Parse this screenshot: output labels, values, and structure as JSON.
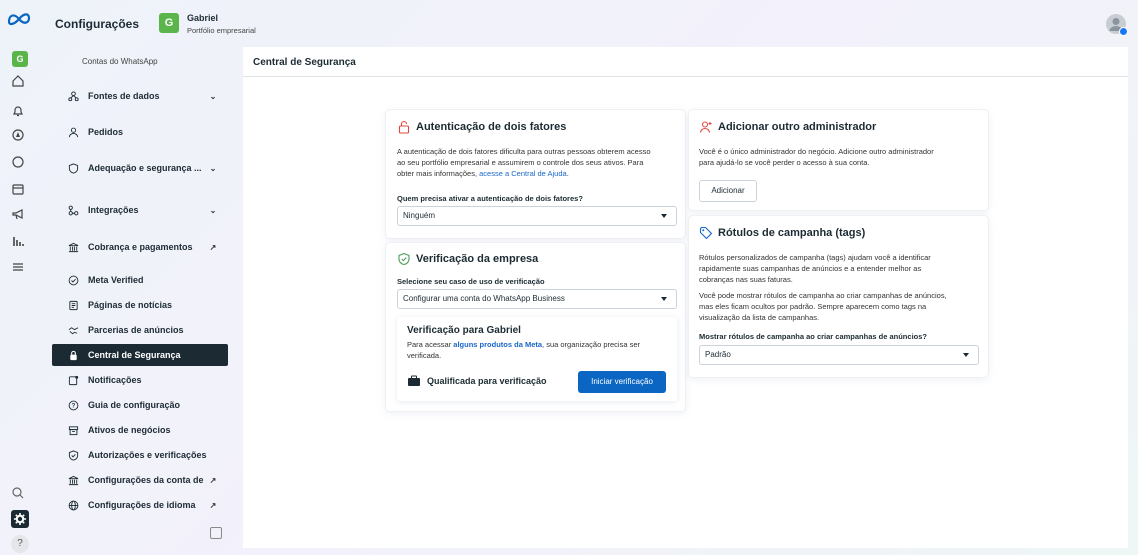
{
  "app": {
    "title": "Configurações"
  },
  "business": {
    "initial": "G",
    "name": "Gabriel",
    "subtitle": "Portfólio empresarial"
  },
  "rail": {
    "badge": "G",
    "icons": [
      "meta-logo-icon",
      "home-icon",
      "bell-icon",
      "compass-icon",
      "circle-icon",
      "calendar-icon",
      "megaphone-icon",
      "chart-icon",
      "menu-icon",
      "search-icon",
      "gear-icon",
      "help-icon"
    ],
    "help_label": "?"
  },
  "sidebar": {
    "subitem": "Contas do WhatsApp",
    "items": [
      {
        "label": "Fontes de dados",
        "icon": "data-sources-icon",
        "trail": "chevron-down"
      },
      {
        "label": "Pedidos",
        "icon": "orders-icon",
        "trail": ""
      },
      {
        "label": "Adequação e segurança ...",
        "icon": "shield-icon",
        "trail": "chevron-down"
      },
      {
        "label": "Integrações",
        "icon": "integrations-icon",
        "trail": "chevron-down"
      },
      {
        "label": "Cobrança e pagamentos",
        "icon": "bank-icon",
        "trail": "external-link"
      },
      {
        "label": "Meta Verified",
        "icon": "verified-icon",
        "trail": ""
      },
      {
        "label": "Páginas de notícias",
        "icon": "news-icon",
        "trail": ""
      },
      {
        "label": "Parcerias de anúncios",
        "icon": "handshake-icon",
        "trail": ""
      },
      {
        "label": "Central de Segurança",
        "icon": "lock-icon",
        "trail": "",
        "active": true
      },
      {
        "label": "Notificações",
        "icon": "notification-icon",
        "trail": ""
      },
      {
        "label": "Guia de configuração",
        "icon": "guide-icon",
        "trail": ""
      },
      {
        "label": "Ativos de negócios",
        "icon": "assets-icon",
        "trail": ""
      },
      {
        "label": "Autorizações e verificações",
        "icon": "authorization-icon",
        "trail": ""
      },
      {
        "label": "Configurações da conta de ...",
        "icon": "account-settings-icon",
        "trail": "external-link"
      },
      {
        "label": "Configurações de idioma",
        "icon": "globe-icon",
        "trail": "external-link"
      }
    ]
  },
  "main": {
    "page_title": "Central de Segurança",
    "two_factor": {
      "title": "Autenticação de dois fatores",
      "desc_1": "A autenticação de dois fatores dificulta para outras pessoas obterem acesso",
      "desc_2": "ao seu portfólio empresarial e assumirem o controle dos seus ativos. Para",
      "desc_3": "obter mais informações, ",
      "desc_link": "acesse a Central de Ajuda",
      "desc_end": ".",
      "question": "Quem precisa ativar a autenticação de dois fatores?",
      "selected": "Ninguém"
    },
    "verification": {
      "title": "Verificação da empresa",
      "use_case_label": "Selecione seu caso de uso de verificação",
      "use_case_selected": "Configurar uma conta do WhatsApp Business",
      "inner_title": "Verificação para Gabriel",
      "inner_desc_1": "Para acessar ",
      "inner_desc_link": "alguns produtos da Meta",
      "inner_desc_2": ", sua organização precisa ser",
      "inner_desc_3": "verificada.",
      "status": "Qualificada para verificação",
      "start_button": "Iniciar verificação"
    },
    "admin": {
      "title": "Adicionar outro administrador",
      "desc_1": "Você é o único administrador do negócio. Adicione outro administrador",
      "desc_2": "para ajudá-lo se você perder o acesso à sua conta.",
      "add_button": "Adicionar"
    },
    "tags": {
      "title": "Rótulos de campanha (tags)",
      "desc_1": "Rótulos personalizados de campanha (tags) ajudam você a identificar",
      "desc_2": "rapidamente suas campanhas de anúncios e a entender melhor as",
      "desc_3": "cobranças nas suas faturas.",
      "desc_4": "Você pode mostrar rótulos de campanha ao criar campanhas de anúncios,",
      "desc_5": "mas eles ficam ocultos por padrão. Sempre aparecem como tags na",
      "desc_6": "visualização da lista de campanhas.",
      "question": "Mostrar rótulos de campanha ao criar campanhas de anúncios?",
      "selected": "Padrão"
    }
  },
  "colors": {
    "accent": "#0a66c2",
    "brand_green": "#5ab54b",
    "danger_icon": "#e0483e",
    "link": "#1b66c9"
  }
}
